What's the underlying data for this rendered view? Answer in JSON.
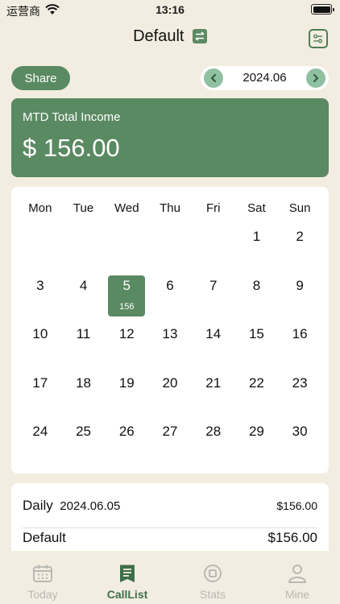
{
  "status_bar": {
    "carrier": "运营商",
    "time": "13:16"
  },
  "header": {
    "title": "Default"
  },
  "toolbar": {
    "share_label": "Share",
    "month": "2024.06"
  },
  "summary": {
    "label": "MTD Total Income",
    "value": "$ 156.00"
  },
  "calendar": {
    "weekdays": [
      "Mon",
      "Tue",
      "Wed",
      "Thu",
      "Fri",
      "Sat",
      "Sun"
    ],
    "days": [
      {
        "day": ""
      },
      {
        "day": ""
      },
      {
        "day": ""
      },
      {
        "day": ""
      },
      {
        "day": ""
      },
      {
        "day": "1"
      },
      {
        "day": "2"
      },
      {
        "day": "3"
      },
      {
        "day": "4"
      },
      {
        "day": "5",
        "income": "156",
        "selected": true
      },
      {
        "day": "6"
      },
      {
        "day": "7"
      },
      {
        "day": "8"
      },
      {
        "day": "9"
      },
      {
        "day": "10"
      },
      {
        "day": "11"
      },
      {
        "day": "12"
      },
      {
        "day": "13"
      },
      {
        "day": "14"
      },
      {
        "day": "15"
      },
      {
        "day": "16"
      },
      {
        "day": "17"
      },
      {
        "day": "18"
      },
      {
        "day": "19"
      },
      {
        "day": "20"
      },
      {
        "day": "21"
      },
      {
        "day": "22"
      },
      {
        "day": "23"
      },
      {
        "day": "24"
      },
      {
        "day": "25"
      },
      {
        "day": "26"
      },
      {
        "day": "27"
      },
      {
        "day": "28"
      },
      {
        "day": "29"
      },
      {
        "day": "30"
      }
    ]
  },
  "daily": {
    "label": "Daily",
    "date": "2024.06.05",
    "total": "$156.00",
    "entries": [
      {
        "name": "Default",
        "amount": "$156.00"
      }
    ]
  },
  "tabs": [
    {
      "label": "Today",
      "icon": "calendar-icon"
    },
    {
      "label": "CallList",
      "icon": "list-icon"
    },
    {
      "label": "Stats",
      "icon": "stats-icon"
    },
    {
      "label": "Mine",
      "icon": "person-icon"
    }
  ],
  "colors": {
    "accent": "#5a8a62",
    "background": "#f3ede1",
    "tab_active": "#3f6f4a",
    "tab_inactive": "#b9b8b3"
  }
}
